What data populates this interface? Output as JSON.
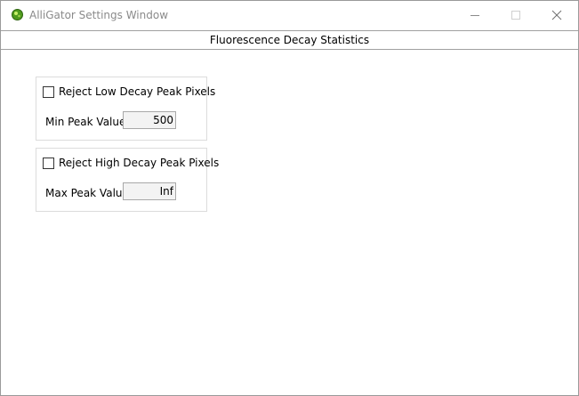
{
  "window": {
    "title": "AlliGator Settings Window"
  },
  "tab": {
    "label": "Fluorescence Decay Statistics"
  },
  "low_group": {
    "checkbox_label": "Reject Low Decay Peak Pixels",
    "checked": false,
    "field_label": "Min Peak Value",
    "field_value": "500"
  },
  "high_group": {
    "checkbox_label": "Reject High Decay Peak Pixels",
    "checked": false,
    "field_label": "Max Peak Value",
    "field_value": "Inf"
  }
}
